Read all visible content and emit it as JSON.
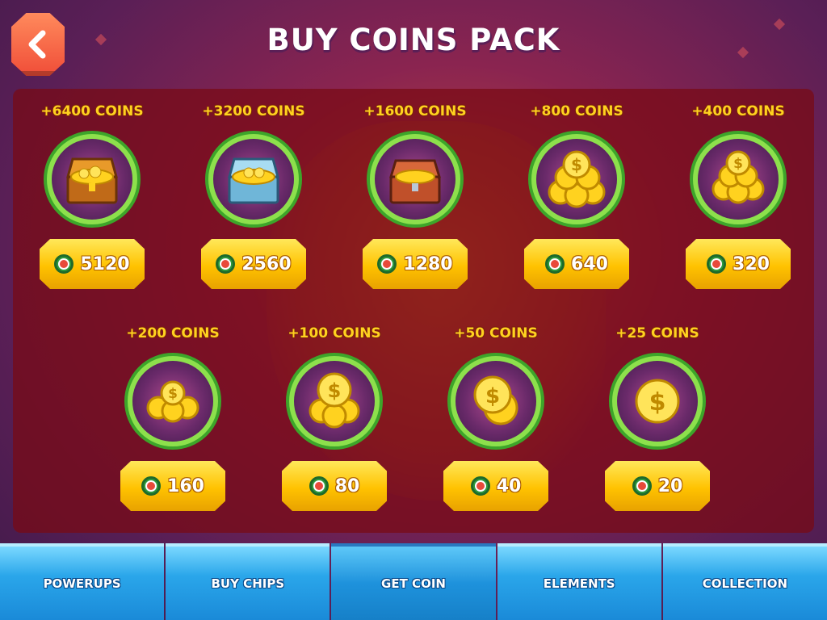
{
  "screen": {
    "title": "BUY COINS PACK",
    "back_icon": "chevron-left-icon"
  },
  "packs": [
    {
      "label": "+6400 COINS",
      "price": "5120",
      "art": "gold-chest"
    },
    {
      "label": "+3200 COINS",
      "price": "2560",
      "art": "silver-chest"
    },
    {
      "label": "+1600 COINS",
      "price": "1280",
      "art": "wood-chest"
    },
    {
      "label": "+800 COINS",
      "price": "640",
      "art": "coin-pile-large"
    },
    {
      "label": "+400 COINS",
      "price": "320",
      "art": "coin-pile-medium"
    },
    {
      "label": "+200 COINS",
      "price": "160",
      "art": "coin-pile-small"
    },
    {
      "label": "+100 COINS",
      "price": "80",
      "art": "coin-stack"
    },
    {
      "label": "+50 COINS",
      "price": "40",
      "art": "two-coins"
    },
    {
      "label": "+25 COINS",
      "price": "20",
      "art": "single-coin"
    }
  ],
  "tabs": [
    {
      "label": "POWERUPS"
    },
    {
      "label": "BUY CHIPS"
    },
    {
      "label": "GET COIN",
      "active": true
    },
    {
      "label": "ELEMENTS"
    },
    {
      "label": "COLLECTION"
    }
  ],
  "colors": {
    "coin_label": "#ffd21f",
    "price_button": "#ffc200",
    "ring": "#8de04c",
    "tab": "#2aa6ea"
  }
}
